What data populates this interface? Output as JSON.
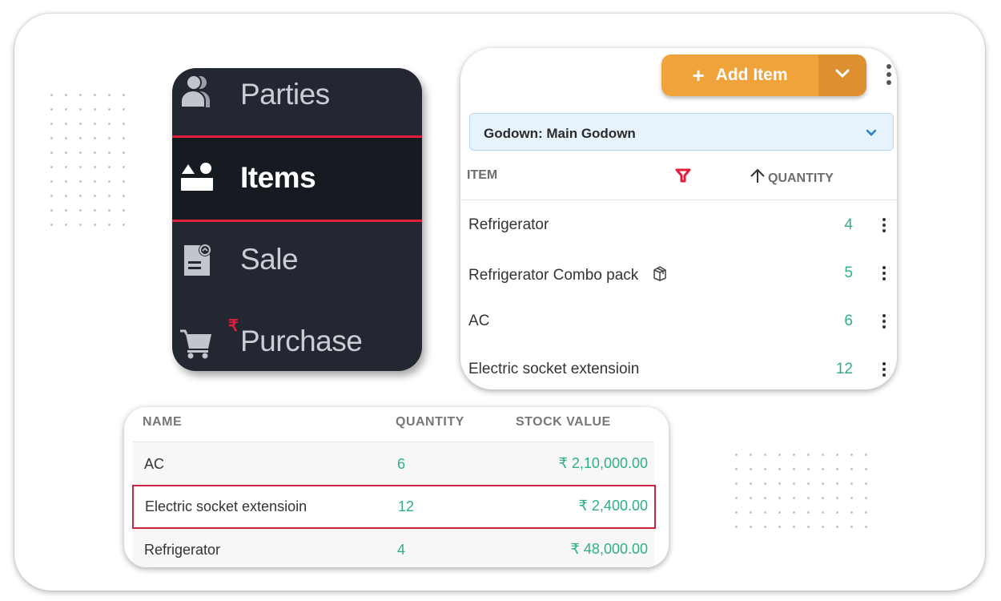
{
  "nav": {
    "items": [
      {
        "label": "Parties",
        "icon": "parties-icon",
        "selected": false
      },
      {
        "label": "Items",
        "icon": "items-icon",
        "selected": true
      },
      {
        "label": "Sale",
        "icon": "sale-icon",
        "selected": false
      },
      {
        "label": "Purchase",
        "icon": "cart-icon",
        "selected": false,
        "badge": "₹"
      }
    ],
    "accent_color": "#e01e3c"
  },
  "items_panel": {
    "add_button": {
      "plus": "+",
      "label": "Add Item",
      "color": "#f0a33b"
    },
    "godown_select": {
      "value": "Godown: Main Godown"
    },
    "columns": {
      "item": "ITEM",
      "quantity": "QUANTITY"
    },
    "rows": [
      {
        "name": "Refrigerator",
        "quantity": "4",
        "combo": false
      },
      {
        "name": "Refrigerator Combo pack",
        "quantity": "5",
        "combo": true
      },
      {
        "name": "AC",
        "quantity": "6",
        "combo": false
      },
      {
        "name": "Electric socket extensioin",
        "quantity": "12",
        "combo": false
      }
    ],
    "quantity_color": "#2fb083"
  },
  "stock_table": {
    "columns": {
      "name": "NAME",
      "quantity": "QUANTITY",
      "stock_value": "STOCK VALUE"
    },
    "rows": [
      {
        "name": "AC",
        "quantity": "6",
        "stock_value": "₹ 2,10,000.00",
        "highlighted": false
      },
      {
        "name": "Electric socket extensioin",
        "quantity": "12",
        "stock_value": "₹ 2,400.00",
        "highlighted": true
      },
      {
        "name": "Refrigerator",
        "quantity": "4",
        "stock_value": "₹ 48,000.00",
        "highlighted": false
      }
    ],
    "highlight_color": "#c8243f"
  }
}
